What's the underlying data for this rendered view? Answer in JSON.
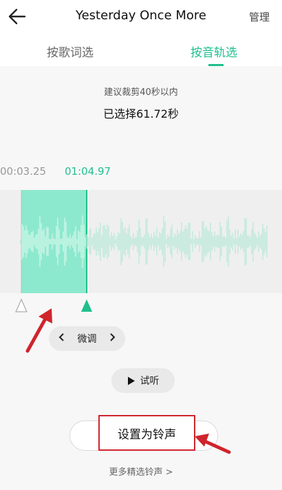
{
  "header": {
    "title": "Yesterday Once More",
    "manage_label": "管理"
  },
  "tabs": [
    {
      "label": "按歌词选",
      "active": false
    },
    {
      "label": "按音轨选",
      "active": true
    }
  ],
  "hint": "建议裁剪40秒以内",
  "selected_text": "已选择61.72秒",
  "timeline": {
    "start_time": "00:03.25",
    "end_time": "01:04.97"
  },
  "controls": {
    "fine_tune_label": "微调",
    "preview_label": "试听",
    "set_ringtone_label": "设置为铃声",
    "more_ringtones_label": "更多精选铃声 >"
  },
  "colors": {
    "accent": "#1fc08c",
    "selection": "#8de9cd",
    "annotation": "#d0242c"
  }
}
